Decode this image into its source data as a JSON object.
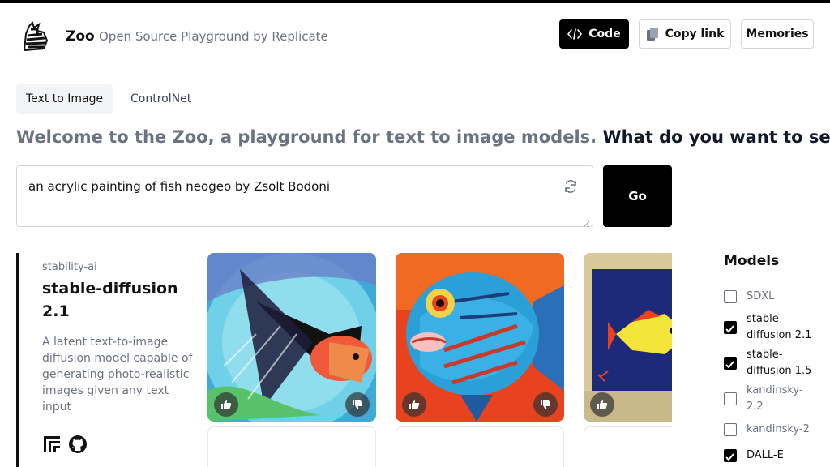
{
  "header": {
    "brand": "Zoo",
    "tagline": "Open Source Playground by Replicate",
    "code_label": "Code",
    "copy_link_label": "Copy link",
    "memories_label": "Memories"
  },
  "tabs": [
    {
      "label": "Text to Image",
      "active": true
    },
    {
      "label": "ControlNet",
      "active": false
    }
  ],
  "headline": {
    "muted": "Welcome to the Zoo, a playground for text to image models.",
    "strong": "What do you want to see?"
  },
  "prompt": {
    "value": "an acrylic painting of fish neogeo by Zsolt Bodoni",
    "go_label": "Go"
  },
  "model_card": {
    "org": "stability-ai",
    "name": "stable-diffusion 2.1",
    "description": "A latent text-to-image diffusion model capable of generating photo-realistic images given any text input"
  },
  "models_panel": {
    "title": "Models",
    "items": [
      {
        "label": "SDXL",
        "checked": false
      },
      {
        "label": "stable-diffusion 2.1",
        "checked": true
      },
      {
        "label": "stable-diffusion 1.5",
        "checked": true
      },
      {
        "label": "kandinsky-2.2",
        "checked": false
      },
      {
        "label": "kandinsky-2",
        "checked": false
      },
      {
        "label": "DALL-E",
        "checked": true
      }
    ]
  },
  "colors": {
    "accent": "#000000",
    "muted_text": "#6b7280"
  }
}
